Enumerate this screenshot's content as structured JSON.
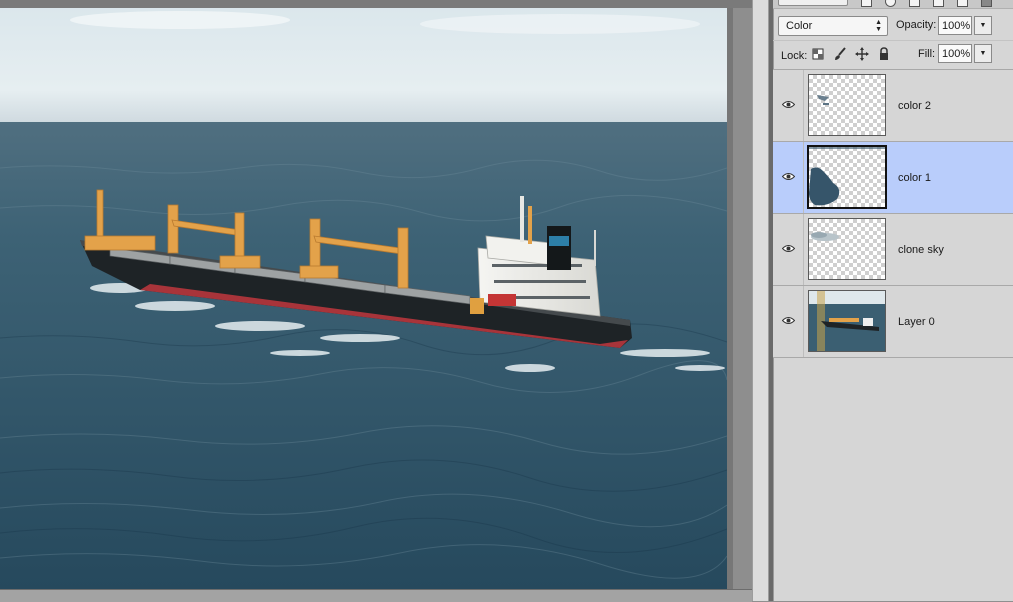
{
  "layers_panel": {
    "blend_mode": "Color",
    "opacity_label": "Opacity:",
    "opacity_value": "100%",
    "lock_label": "Lock:",
    "fill_label": "Fill:",
    "fill_value": "100%",
    "layers": [
      {
        "name": "color 2",
        "visible": true,
        "selected": false,
        "thumb": "transparent-with-small-mark"
      },
      {
        "name": "color 1",
        "visible": true,
        "selected": true,
        "thumb": "transparent-with-blue-blob"
      },
      {
        "name": "clone sky",
        "visible": true,
        "selected": false,
        "thumb": "transparent-with-cloud-strip"
      },
      {
        "name": "Layer 0",
        "visible": true,
        "selected": false,
        "thumb": "ship-photo"
      }
    ]
  },
  "icons": {
    "visibility": "eye-icon",
    "lock_transparent": "checkerboard-lock-icon",
    "lock_pixels": "brush-icon",
    "lock_position": "move-arrows-icon",
    "lock_all": "padlock-icon"
  },
  "colors": {
    "selection_highlight": "#b9cdfb",
    "panel_bg": "#d6d6d6",
    "sea": "#2f5468",
    "sky": "#e3ecf0",
    "hull": "#1e2326",
    "hull_bottom": "#a8343a",
    "cranes": "#e3a24a"
  }
}
